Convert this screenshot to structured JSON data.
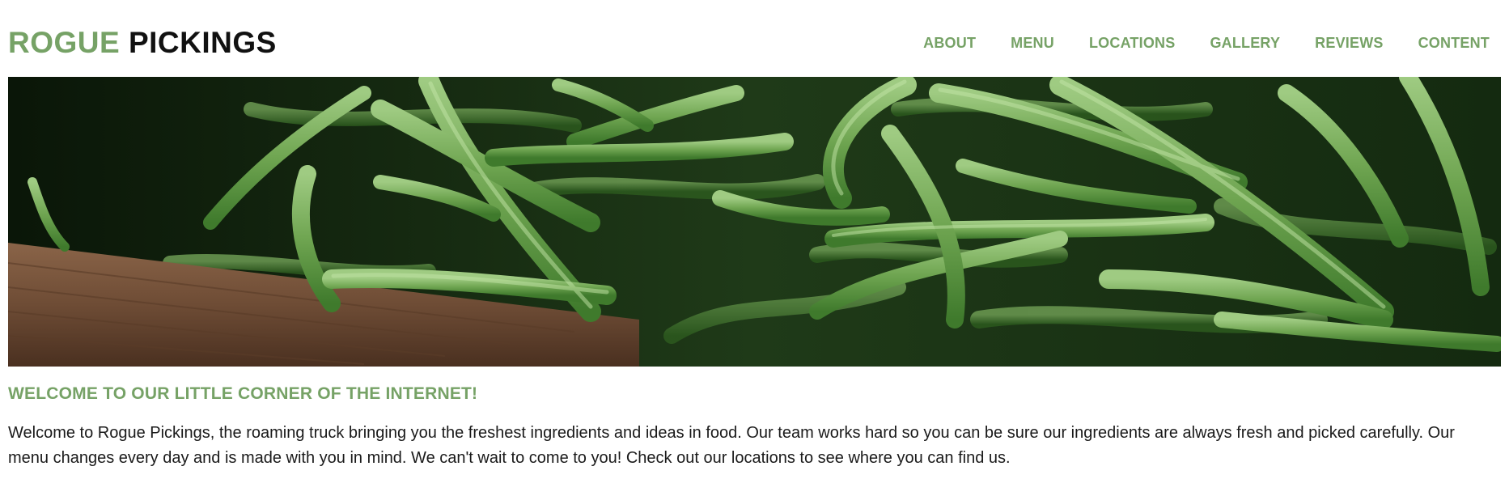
{
  "header": {
    "logo_part1": "ROGUE",
    "logo_part2": "PICKINGS",
    "brand_color": "#76a266"
  },
  "nav": {
    "items": [
      "ABOUT",
      "MENU",
      "LOCATIONS",
      "GALLERY",
      "REVIEWS",
      "CONTENT"
    ]
  },
  "hero": {
    "image_subject": "green beans in wooden crate",
    "icon": "green-beans-photo"
  },
  "welcome": {
    "title": "WELCOME TO OUR LITTLE CORNER OF THE INTERNET!",
    "body": "Welcome to Rogue Pickings, the roaming truck bringing you the freshest ingredients and ideas in food. Our team works hard so you can be sure our ingredients are always fresh and picked carefully. Our menu changes every day and is made with you in mind. We can't wait to come to you! Check out our locations to see where you can find us."
  }
}
